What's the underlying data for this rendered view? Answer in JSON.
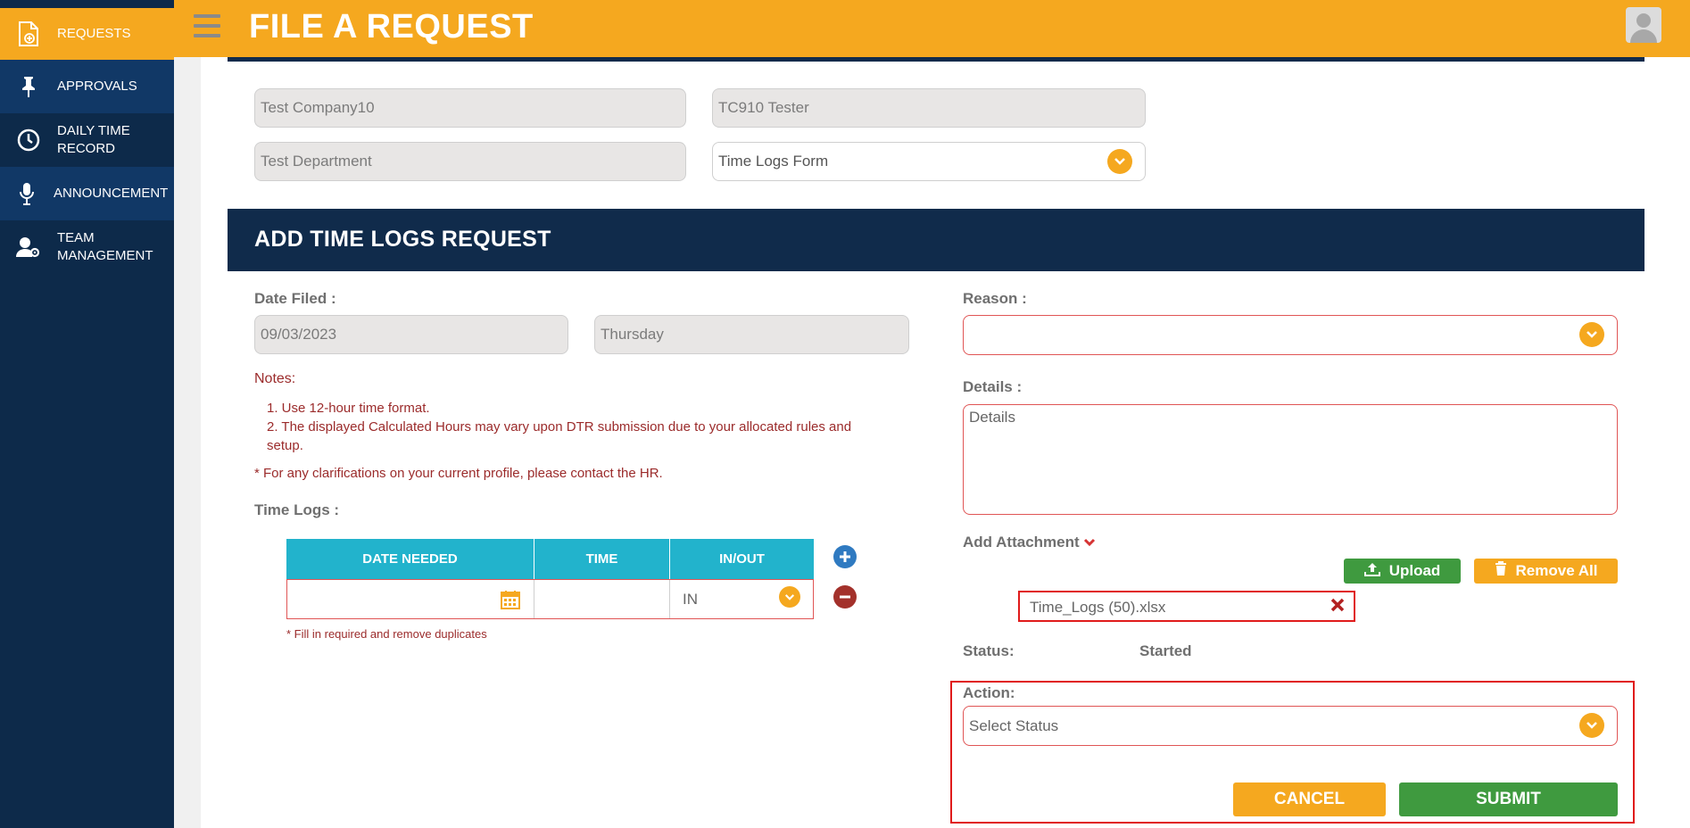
{
  "sidebar": {
    "items": [
      {
        "label": "REQUESTS",
        "icon": "file-plus-icon"
      },
      {
        "label": "APPROVALS",
        "icon": "pin-icon"
      },
      {
        "label": "DAILY TIME RECORD",
        "icon": "clock-icon"
      },
      {
        "label": "ANNOUNCEMENT",
        "icon": "microphone-icon"
      },
      {
        "label": "TEAM MANAGEMENT",
        "icon": "user-gear-icon"
      }
    ]
  },
  "header": {
    "title": "FILE A REQUEST"
  },
  "profile": {
    "company": "Test Company10",
    "name": "TC910 Tester",
    "department": "Test Department",
    "form_type": "Time Logs Form"
  },
  "section": {
    "title": "ADD TIME LOGS REQUEST"
  },
  "left": {
    "date_filed_label": "Date Filed :",
    "date_filed": "09/03/2023",
    "day": "Thursday",
    "notes_label": "Notes:",
    "note1": "1. Use 12-hour time format.",
    "note2": "2. The displayed Calculated Hours may vary upon DTR submission due to your allocated rules and setup.",
    "clarification": "* For any clarifications on your current profile, please contact the HR.",
    "time_logs_label": "Time Logs :",
    "table": {
      "headers": [
        "DATE NEEDED",
        "TIME",
        "IN/OUT"
      ],
      "row": {
        "date": "",
        "time": "",
        "inout": "IN"
      }
    },
    "fill_note": "* Fill in required and remove duplicates"
  },
  "right": {
    "reason_label": "Reason :",
    "reason_value": "",
    "details_label": "Details :",
    "details_placeholder": "Details",
    "attachment_label": "Add Attachment",
    "upload_label": "Upload",
    "remove_all_label": "Remove All",
    "file_name": "Time_Logs (50).xlsx",
    "status_label": "Status:",
    "status_value": "Started",
    "action_label": "Action:",
    "action_placeholder": "Select Status",
    "cancel_label": "CANCEL",
    "submit_label": "SUBMIT"
  },
  "colors": {
    "accent": "#f5a81f",
    "navy": "#102b4b",
    "teal": "#22b3cc",
    "green": "#3f9a3f",
    "error_red": "#e01b1b"
  }
}
